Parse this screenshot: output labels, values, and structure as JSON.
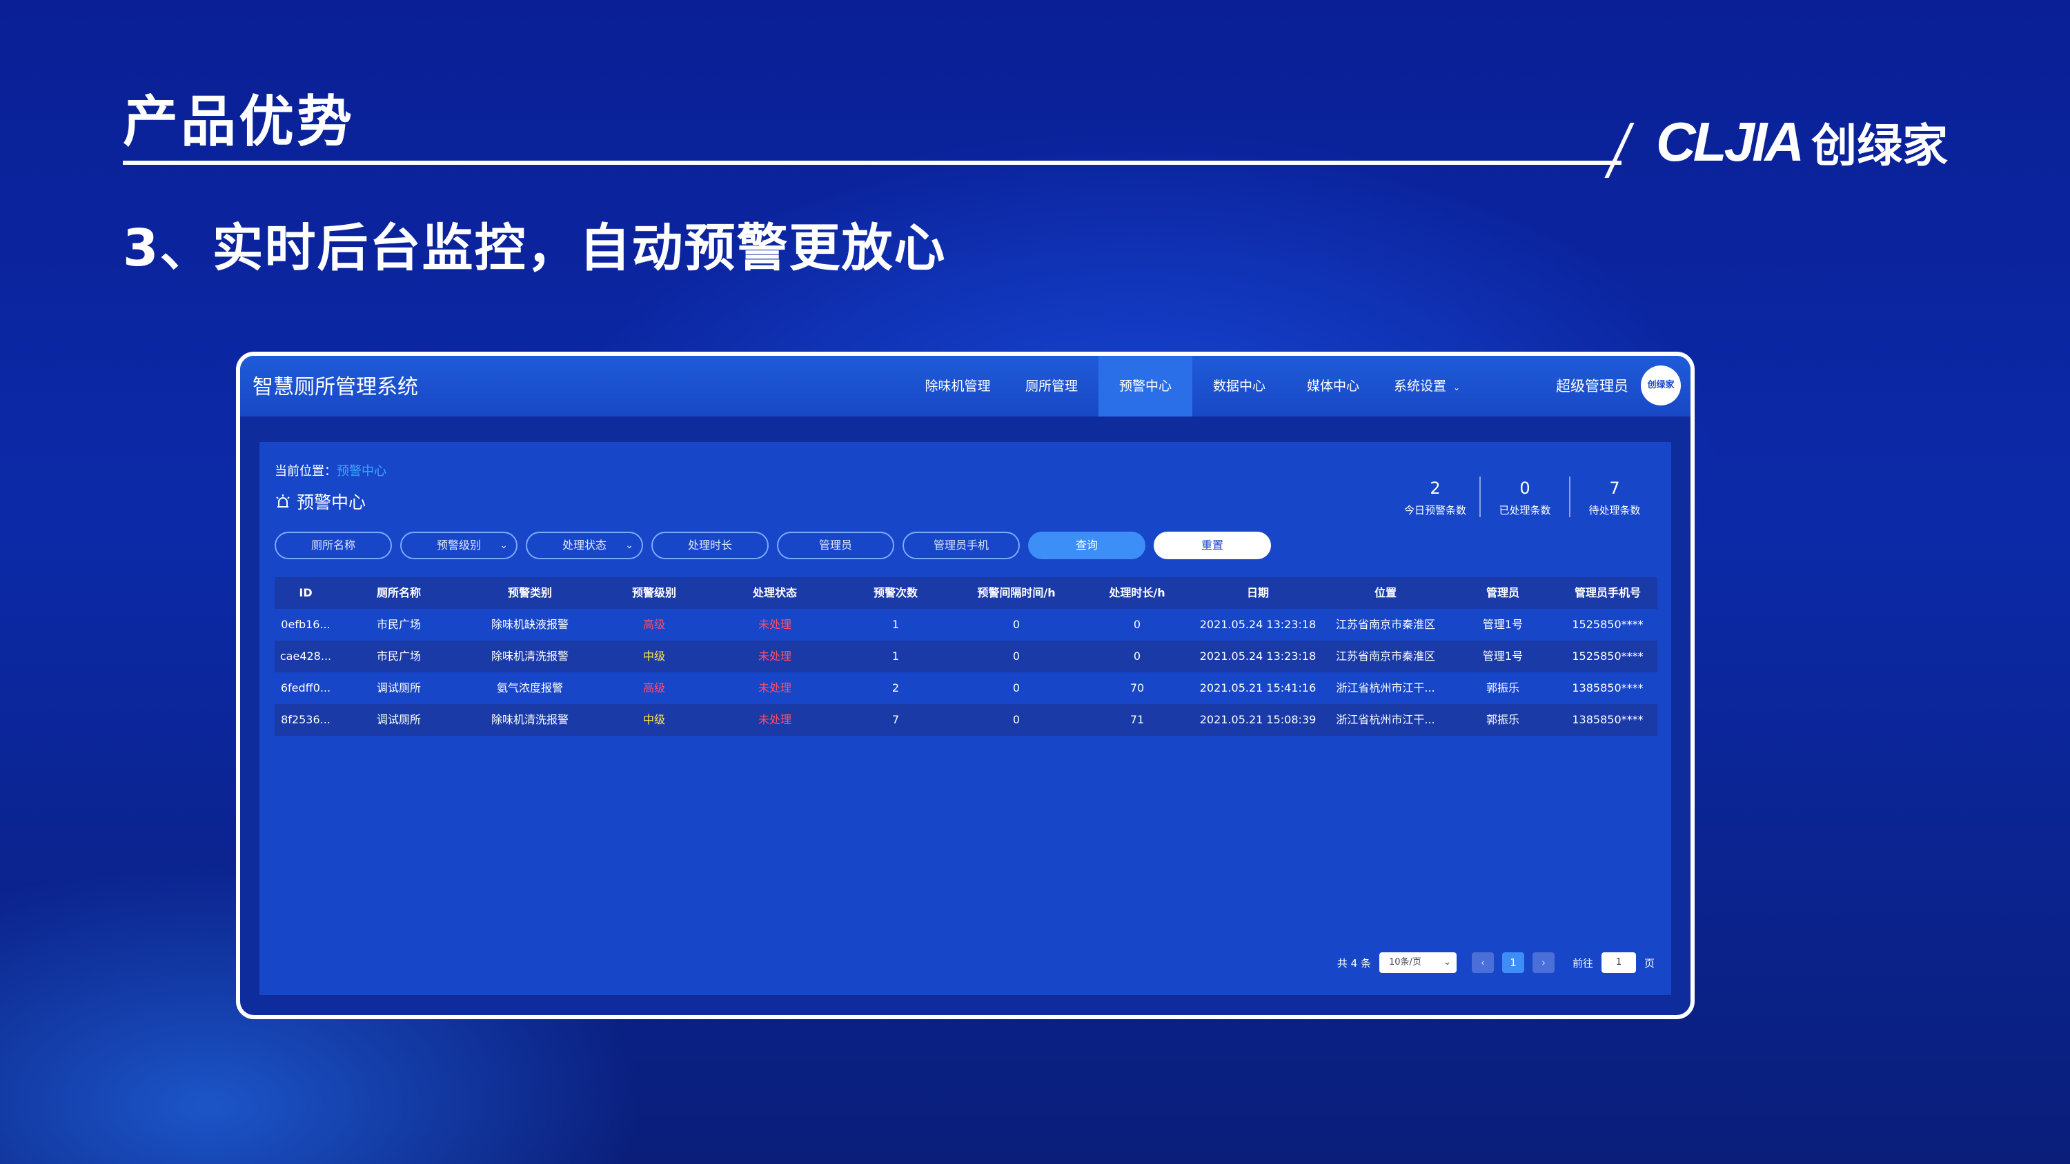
{
  "slide": {
    "title": "产品优势",
    "subtitle": "3、实时后台监控，自动预警更放心",
    "brand_mark": "CLJIA",
    "brand_name": "创绿家"
  },
  "app": {
    "title": "智慧厕所管理系统",
    "nav": [
      "除味机管理",
      "厕所管理",
      "预警中心",
      "数据中心",
      "媒体中心",
      "系统设置"
    ],
    "active_nav": "预警中心",
    "user": "超级管理员",
    "avatar_text": "创绿家"
  },
  "breadcrumb": {
    "prefix": "当前位置：",
    "current": "预警中心"
  },
  "section_title": "预警中心",
  "stats": [
    {
      "value": "2",
      "label": "今日预警条数"
    },
    {
      "value": "0",
      "label": "已处理条数"
    },
    {
      "value": "7",
      "label": "待处理条数"
    }
  ],
  "filters": {
    "toilet_name": "厕所名称",
    "alarm_level": "预警级别",
    "process_status": "处理状态",
    "process_duration": "处理时长",
    "manager": "管理员",
    "manager_phone": "管理员手机",
    "query": "查询",
    "reset": "重置"
  },
  "table": {
    "headers": [
      "ID",
      "厕所名称",
      "预警类别",
      "预警级别",
      "处理状态",
      "预警次数",
      "预警间隔时间/h",
      "处理时长/h",
      "日期",
      "位置",
      "管理员",
      "管理员手机号"
    ],
    "rows": [
      [
        "0efb16...",
        "市民广场",
        "除味机缺液报警",
        "高级",
        "未处理",
        "1",
        "0",
        "0",
        "2021.05.24 13:23:18",
        "江苏省南京市秦淮区",
        "管理1号",
        "1525850****"
      ],
      [
        "cae428...",
        "市民广场",
        "除味机清洗报警",
        "中级",
        "未处理",
        "1",
        "0",
        "0",
        "2021.05.24 13:23:18",
        "江苏省南京市秦淮区",
        "管理1号",
        "1525850****"
      ],
      [
        "6fedff0...",
        "调试厕所",
        "氨气浓度报警",
        "高级",
        "未处理",
        "2",
        "0",
        "70",
        "2021.05.21 15:41:16",
        "浙江省杭州市江干...",
        "郭振乐",
        "1385850****"
      ],
      [
        "8f2536...",
        "调试厕所",
        "除味机清洗报警",
        "中级",
        "未处理",
        "7",
        "0",
        "71",
        "2021.05.21 15:08:39",
        "浙江省杭州市江干...",
        "郭振乐",
        "1385850****"
      ]
    ]
  },
  "pager": {
    "total": "共 4 条",
    "page_size": "10条/页",
    "prev": "‹",
    "page": "1",
    "next": "›",
    "goto_prefix": "前往",
    "goto_value": "1",
    "goto_suffix": "页"
  },
  "colors": {
    "high": "#ff4d6a",
    "mid": "#ffe84a",
    "accent": "#3d8ef6"
  }
}
